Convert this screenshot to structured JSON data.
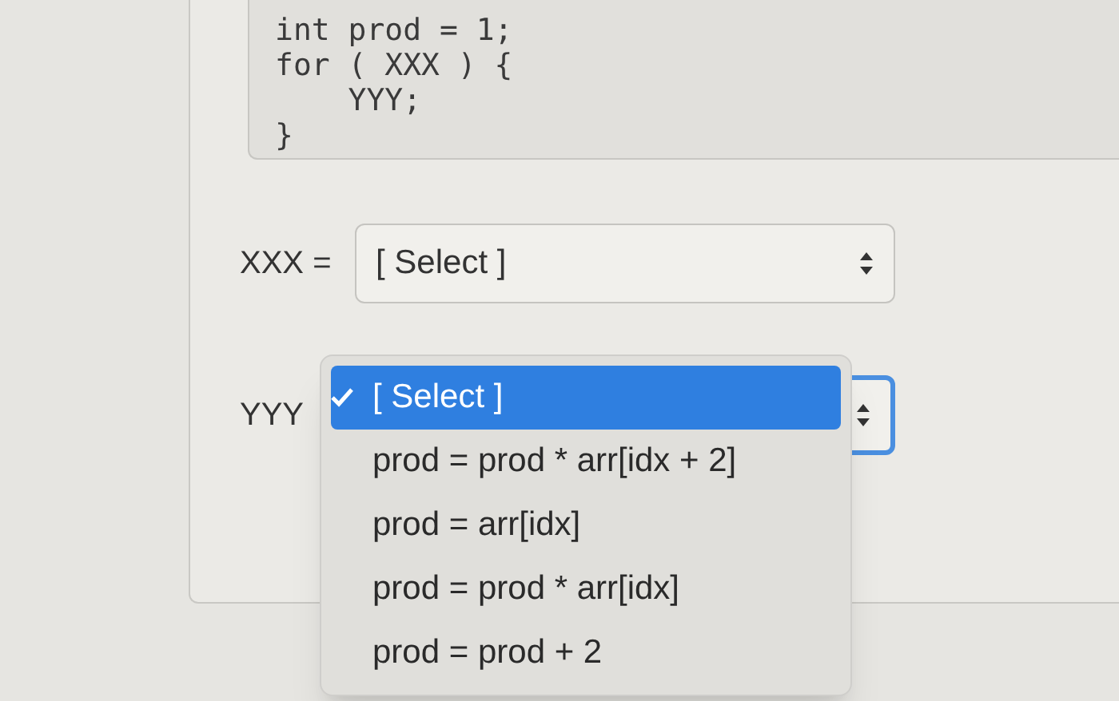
{
  "code": [
    "int prod = 1;",
    "for ( XXX ) {",
    "    YYY;",
    "}"
  ],
  "fields": [
    {
      "label": "XXX =",
      "value": "[ Select ]",
      "focused": false
    },
    {
      "label": "YYY",
      "focused": true
    }
  ],
  "menu": {
    "items": [
      {
        "label": "[ Select ]",
        "selected": true
      },
      {
        "label": "prod = prod * arr[idx + 2]",
        "selected": false
      },
      {
        "label": "prod = arr[idx]",
        "selected": false
      },
      {
        "label": "prod = prod * arr[idx]",
        "selected": false
      },
      {
        "label": "prod = prod + 2",
        "selected": false
      }
    ]
  }
}
